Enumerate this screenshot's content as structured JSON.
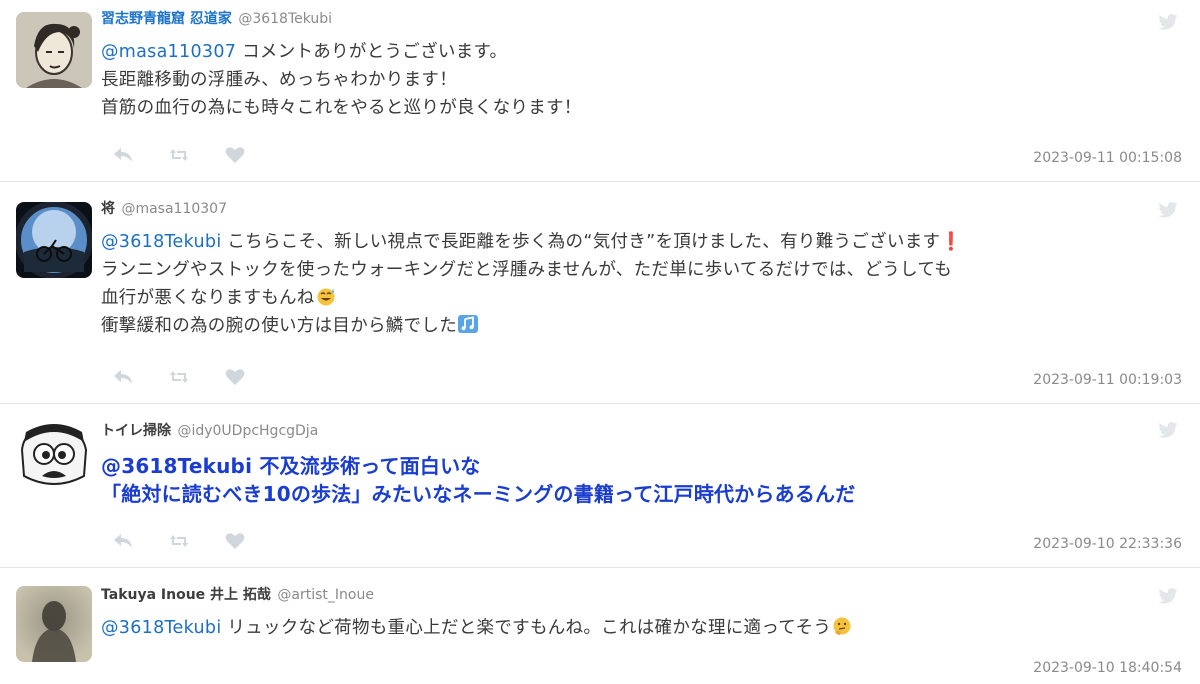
{
  "tweets": [
    {
      "name": "習志野青龍窟 忍道家",
      "handle": "@3618Tekubi",
      "mention": "@masa110307",
      "lines": [
        "コメントありがとうございます。",
        "長距離移動の浮腫み、めっちゃわかります！",
        "首筋の血行の為にも時々これをやると巡りが良くなります！"
      ],
      "time": "2023-09-11 00:15:08"
    },
    {
      "name": "将",
      "handle": "@masa110307",
      "mention": "@3618Tekubi",
      "lines": [
        "こちらこそ、新しい視点で長距離を歩く為の“気付き”を頂けました、有り難うございます",
        "ランニングやストックを使ったウォーキングだと浮腫みませんが、ただ単に歩いてるだけでは、どうしても",
        "血行が悪くなりますもんね",
        "衝撃緩和の為の腕の使い方は目から鱗でした"
      ],
      "time": "2023-09-11 00:19:03"
    },
    {
      "name": "トイレ掃除",
      "handle": "@idy0UDpcHgcgDja",
      "mention": "@3618Tekubi",
      "lines": [
        "不及流歩術って面白いな",
        "「絶対に読むべき10の歩法」みたいなネーミングの書籍って江戸時代からあるんだ"
      ],
      "time": "2023-09-10 22:33:36"
    },
    {
      "name": "Takuya Inoue 井上 拓哉",
      "handle": "@artist_Inoue",
      "mention": "@3618Tekubi",
      "lines": [
        "リュックなど荷物も重心上だと楽ですもんね。これは確かな理に適ってそう"
      ],
      "time": "2023-09-10 18:40:54"
    }
  ],
  "colors": {
    "mention": "#1e6fc1",
    "highlight_text": "#1a3dcf",
    "meta": "#8a8a8a"
  },
  "icons": [
    "reply-icon",
    "retweet-icon",
    "like-icon",
    "twitter-bird-icon"
  ]
}
